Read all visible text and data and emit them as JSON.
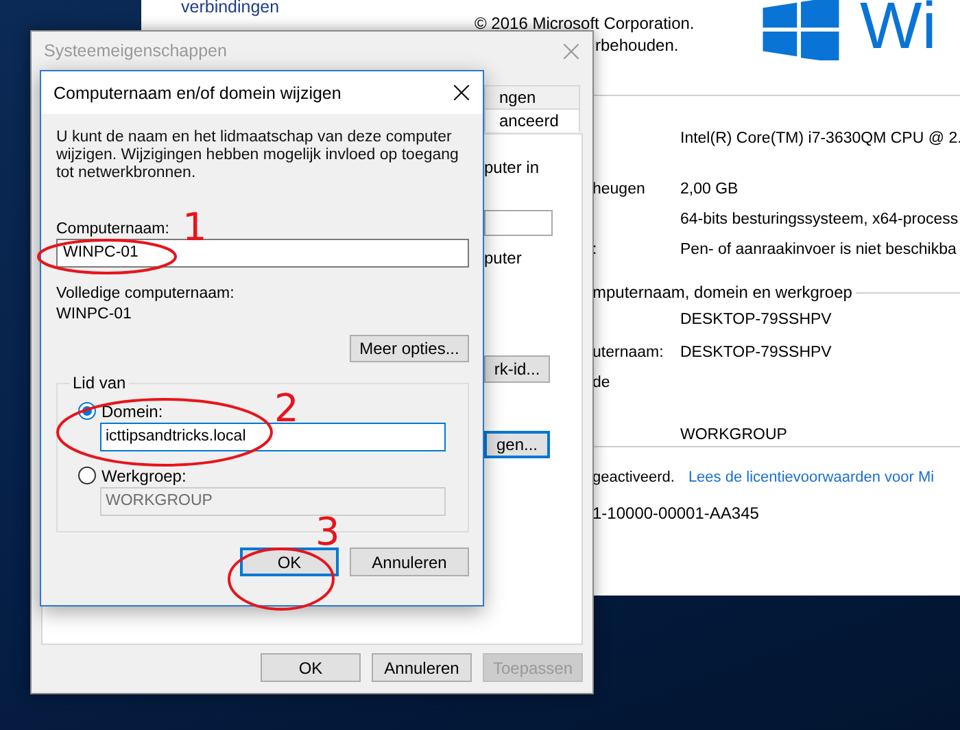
{
  "back_window": {
    "top_link": "verbindingen",
    "copyright": [
      "© 2016 Microsoft Corporation.",
      "rbehouden."
    ],
    "logo_text": "Wi",
    "specs": [
      {
        "value": "Intel(R) Core(TM) i7-3630QM CPU @ 2."
      },
      {
        "label": "heugen",
        "value": "2,00 GB"
      },
      {
        "value": "64-bits besturingssysteem, x64-process"
      },
      {
        "label": ":",
        "value": "Pen- of aanraakinvoer is niet beschikba"
      }
    ],
    "section_title": "mputernaam, domein en werkgroep",
    "names": [
      {
        "value": "DESKTOP-79SSHPV"
      },
      {
        "label": "uternaam:",
        "value": "DESKTOP-79SSHPV"
      },
      {
        "label": "de"
      },
      {
        "value": "WORKGROUP"
      }
    ],
    "activation": {
      "status": "geactiveerd.",
      "link": "Lees de licentievoorwaarden voor Mi"
    },
    "product_id": "1-10000-00001-AA345"
  },
  "system_properties": {
    "title": "Systeemeigenschappen",
    "tabs": [
      {
        "label": "ngen",
        "selected": false
      },
      {
        "label": "anceerd",
        "selected": true
      }
    ],
    "panel": {
      "text_1": "puter in",
      "text_2": "puter",
      "button_1": "rk-id...",
      "button_2": "gen..."
    },
    "buttons": [
      {
        "label": "OK",
        "disabled": false
      },
      {
        "label": "Annuleren",
        "disabled": false
      },
      {
        "label": "Toepassen",
        "disabled": true
      }
    ]
  },
  "change_dialog": {
    "title": "Computernaam en/of domein wijzigen",
    "intro": "U kunt de naam en het lidmaatschap van deze computer wijzigen. Wijzigingen hebben mogelijk invloed op toegang tot netwerkbronnen.",
    "name_label": "Computernaam:",
    "name_value": "WINPC-01",
    "full_name_label": "Volledige computernaam:",
    "full_name": "WINPC-01",
    "more_button": "Meer opties...",
    "group_title": "Lid van",
    "members": [
      {
        "label": "Domein:",
        "selected": true,
        "value": "icttipsandtricks.local",
        "disabled": false
      },
      {
        "label": "Werkgroep:",
        "selected": false,
        "value": "WORKGROUP",
        "disabled": true
      }
    ],
    "buttons": [
      {
        "label": "OK",
        "default": true
      },
      {
        "label": "Annuleren",
        "default": false
      }
    ]
  },
  "annotations": [
    {
      "number": "1"
    },
    {
      "number": "2"
    },
    {
      "number": "3"
    }
  ]
}
